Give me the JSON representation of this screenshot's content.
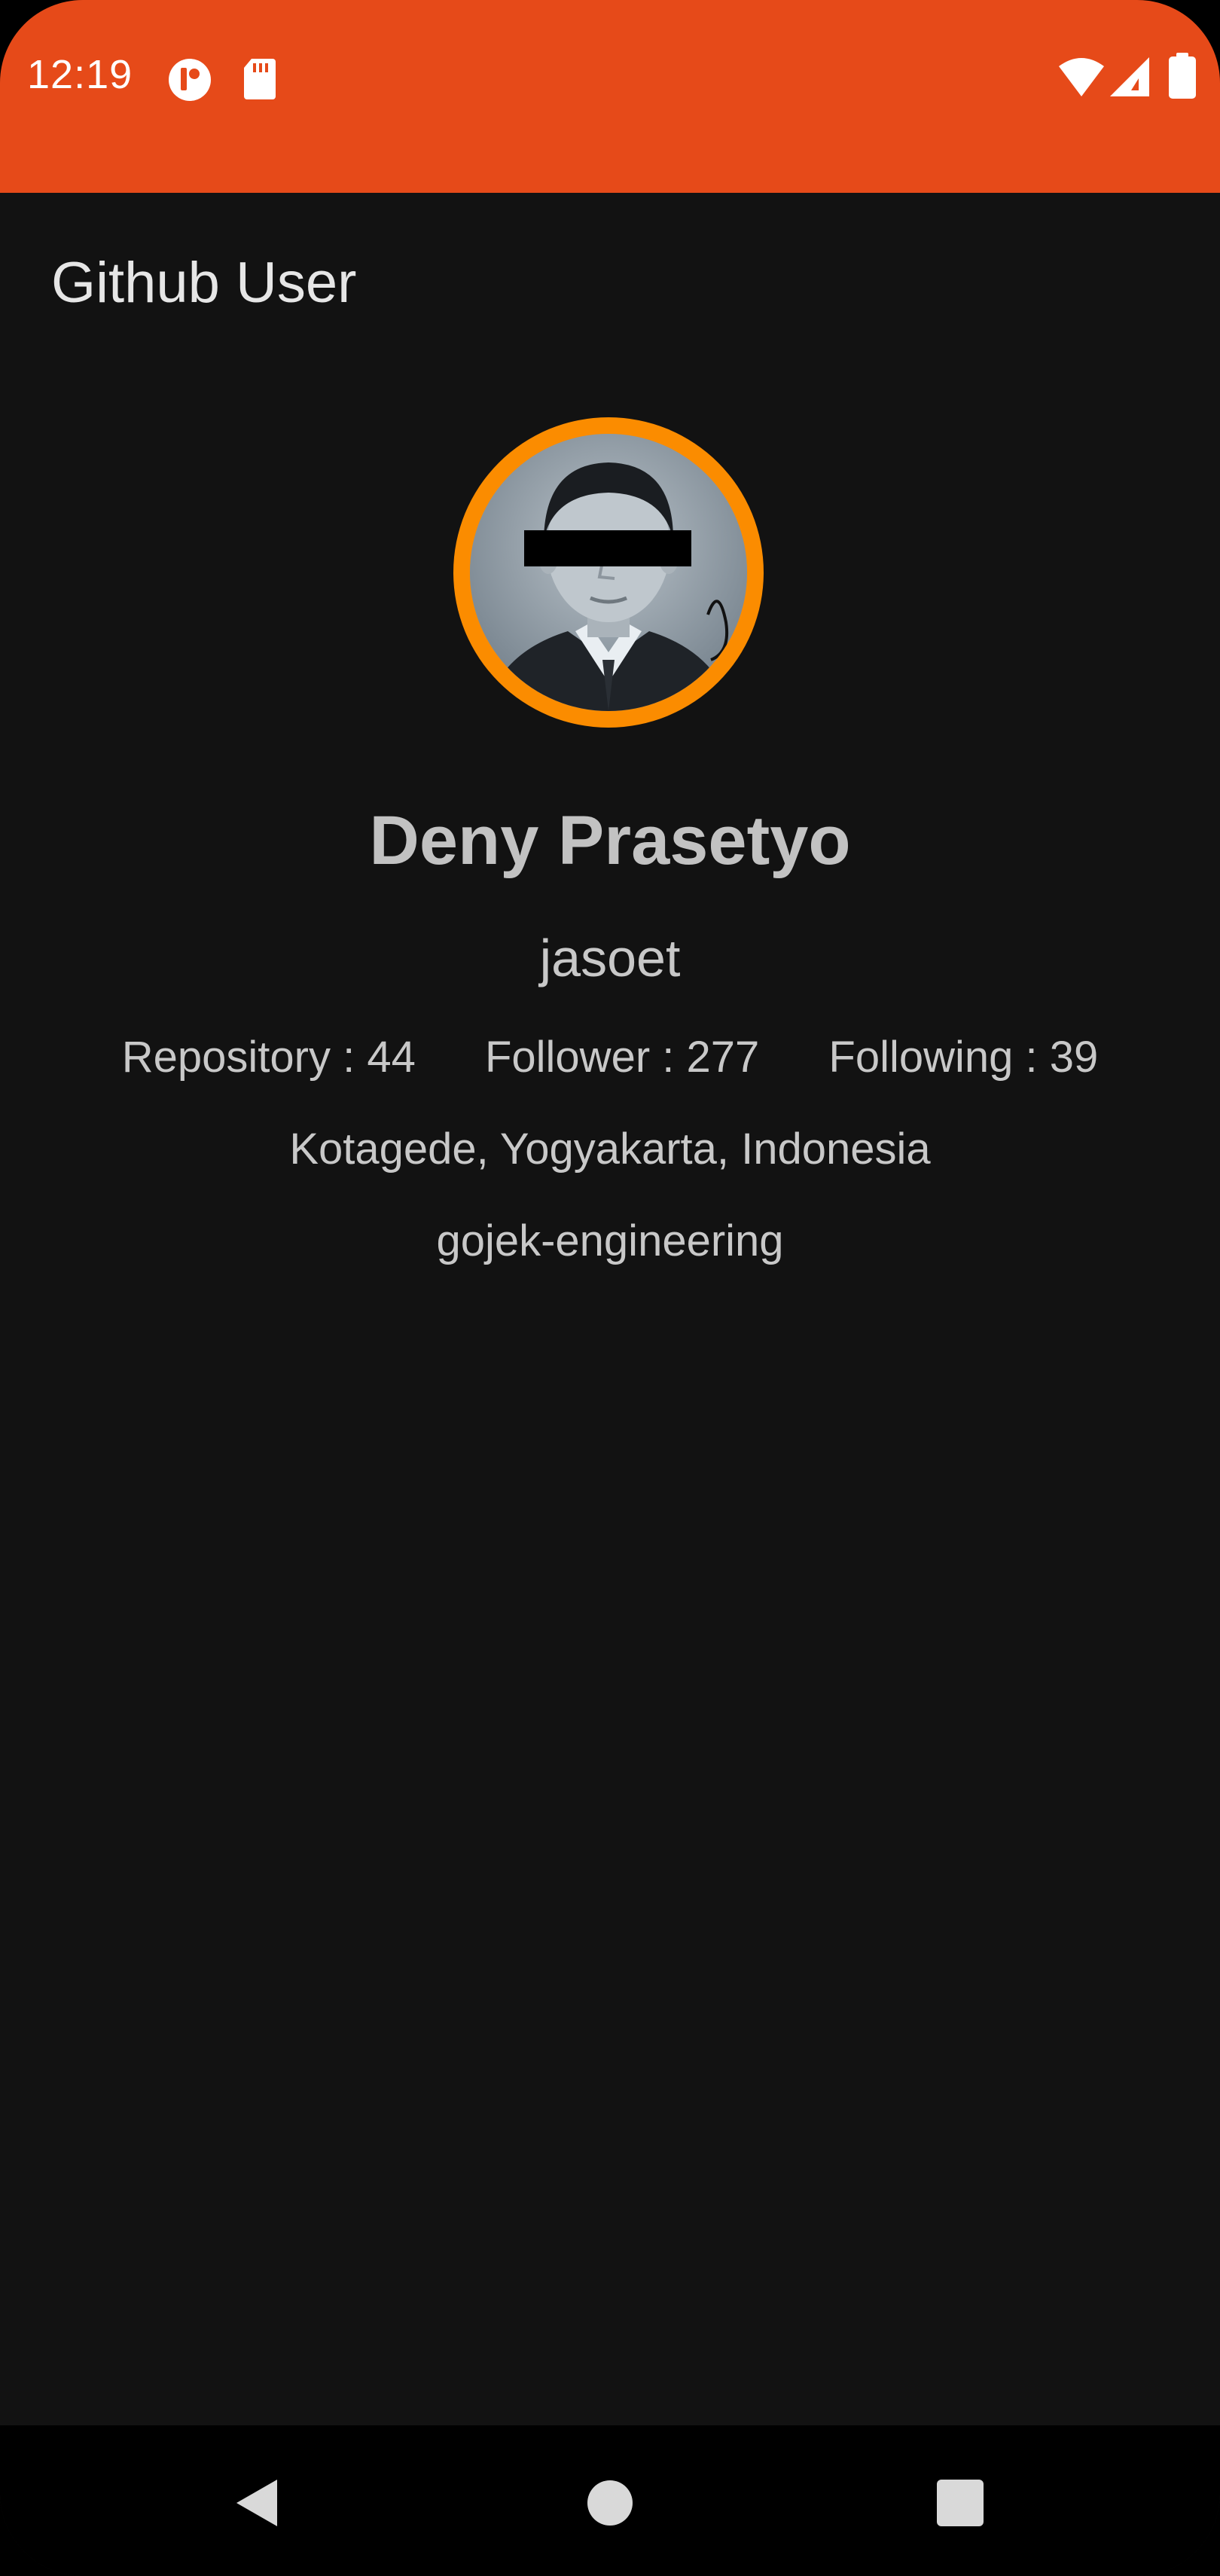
{
  "status_bar": {
    "time": "12:19",
    "color": "#E64A19",
    "left_icons": [
      "app-notification-icon",
      "sd-card-icon"
    ],
    "right_icons": [
      "wifi-icon",
      "signal-icon",
      "battery-icon"
    ]
  },
  "app_bar": {
    "title": "Github User"
  },
  "profile": {
    "avatar_ring_color": "#FB8C00",
    "name": "Deny Prasetyo",
    "username": "jasoet",
    "repository_label": "Repository : 44",
    "follower_label": "Follower : 277",
    "following_label": "Following : 39",
    "location": "Kotagede, Yogyakarta, Indonesia",
    "company": "gojek-engineering"
  },
  "nav_bar": {
    "buttons": [
      "back-icon",
      "home-icon",
      "recents-icon"
    ]
  }
}
